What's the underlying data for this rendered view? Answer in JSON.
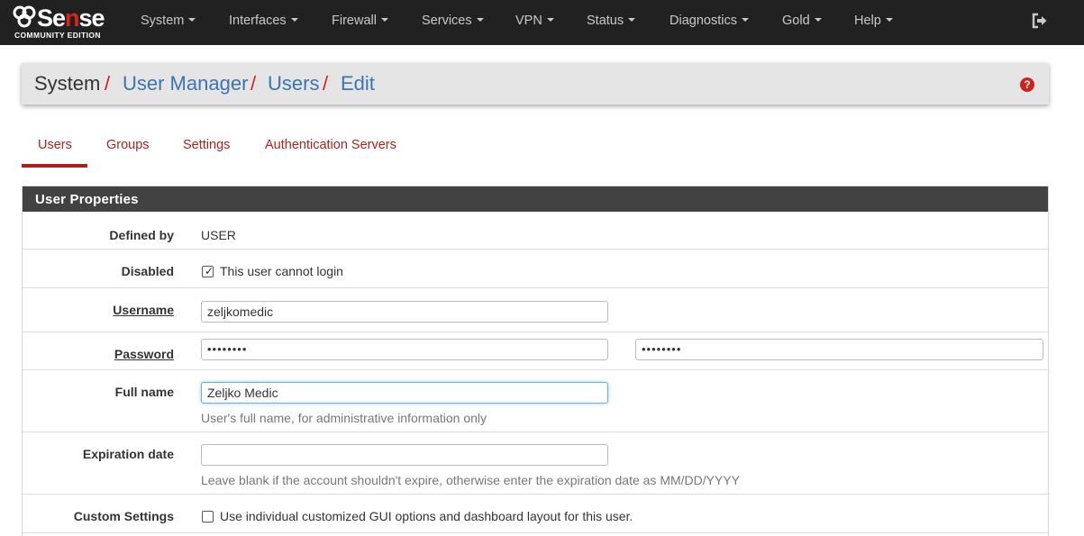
{
  "brand": {
    "name_prefix": "Se",
    "name_highlight": "n",
    "name_suffix": "se",
    "edition": "COMMUNITY EDITION"
  },
  "nav": {
    "items": [
      "System",
      "Interfaces",
      "Firewall",
      "Services",
      "VPN",
      "Status",
      "Diagnostics",
      "Gold",
      "Help"
    ],
    "logout_icon": "sign-out-icon"
  },
  "breadcrumb": {
    "root": "System",
    "items": [
      "User Manager",
      "Users",
      "Edit"
    ],
    "separator": "/",
    "help_icon": "question-circle-icon"
  },
  "tabs": [
    {
      "label": "Users",
      "active": true
    },
    {
      "label": "Groups",
      "active": false
    },
    {
      "label": "Settings",
      "active": false
    },
    {
      "label": "Authentication Servers",
      "active": false
    }
  ],
  "panel": {
    "title": "User Properties",
    "defined_by": {
      "label": "Defined by",
      "value": "USER"
    },
    "disabled": {
      "label": "Disabled",
      "checked": true,
      "text": "This user cannot login"
    },
    "username": {
      "label": "Username",
      "value": "zeljkomedic"
    },
    "password": {
      "label": "Password",
      "value": "••••••••",
      "confirm_value": "••••••••"
    },
    "full_name": {
      "label": "Full name",
      "value": "Zeljko Medic",
      "help": "User's full name, for administrative information only"
    },
    "expiration": {
      "label": "Expiration date",
      "value": "",
      "help": "Leave blank if the account shouldn't expire, otherwise enter the expiration date as MM/DD/YYYY"
    },
    "custom_settings": {
      "label": "Custom Settings",
      "checked": false,
      "text": "Use individual customized GUI options and dashboard layout for this user."
    }
  },
  "colors": {
    "navbar": "#212121",
    "accent_red": "#a9231c",
    "link_blue": "#3d75b0",
    "panel_head": "#424242",
    "crumb_bg": "#e5e5e5"
  }
}
